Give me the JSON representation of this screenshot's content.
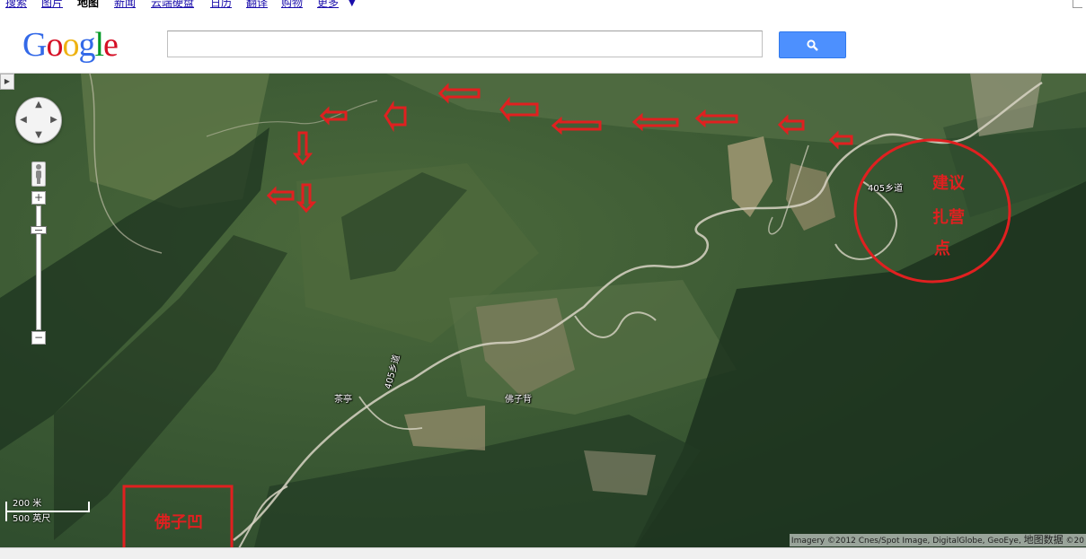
{
  "nav": {
    "items": [
      "搜索",
      "图片",
      "地图",
      "新闻",
      "云端硬盘",
      "日历",
      "翻译",
      "购物",
      "更多"
    ],
    "active": "地图"
  },
  "logo": {
    "text": "Google",
    "colors": [
      "#3369e8",
      "#d50f25",
      "#eeb211",
      "#3369e8",
      "#009925",
      "#d50f25"
    ]
  },
  "search": {
    "value": "",
    "button_icon": "search-icon",
    "button_color": "#4d90fe"
  },
  "map": {
    "view": "satellite",
    "place_labels": {
      "road_405_top": "405乡道",
      "road_405_mid": "405乡道",
      "chating": "茶亭",
      "fozibei": "佛子背"
    },
    "annotations": {
      "campsite_lines": [
        "建议",
        "扎营",
        "点"
      ],
      "fozi_ao": "佛子凹",
      "annotation_color": "#e02020"
    },
    "scale": {
      "metric": "200 米",
      "imperial": "500 英尺"
    },
    "attribution": {
      "text": "Imagery ©2012 Cnes/Spot Image, DigitalGlobe, GeoEye, ",
      "data_label": "地图数据",
      "trailing": " ©20"
    }
  },
  "controls": {
    "pan_icon": "pan-control-icon",
    "pegman_icon": "pegman-icon",
    "zoom_in": "+",
    "zoom_out": "−",
    "toggle": "▶"
  }
}
